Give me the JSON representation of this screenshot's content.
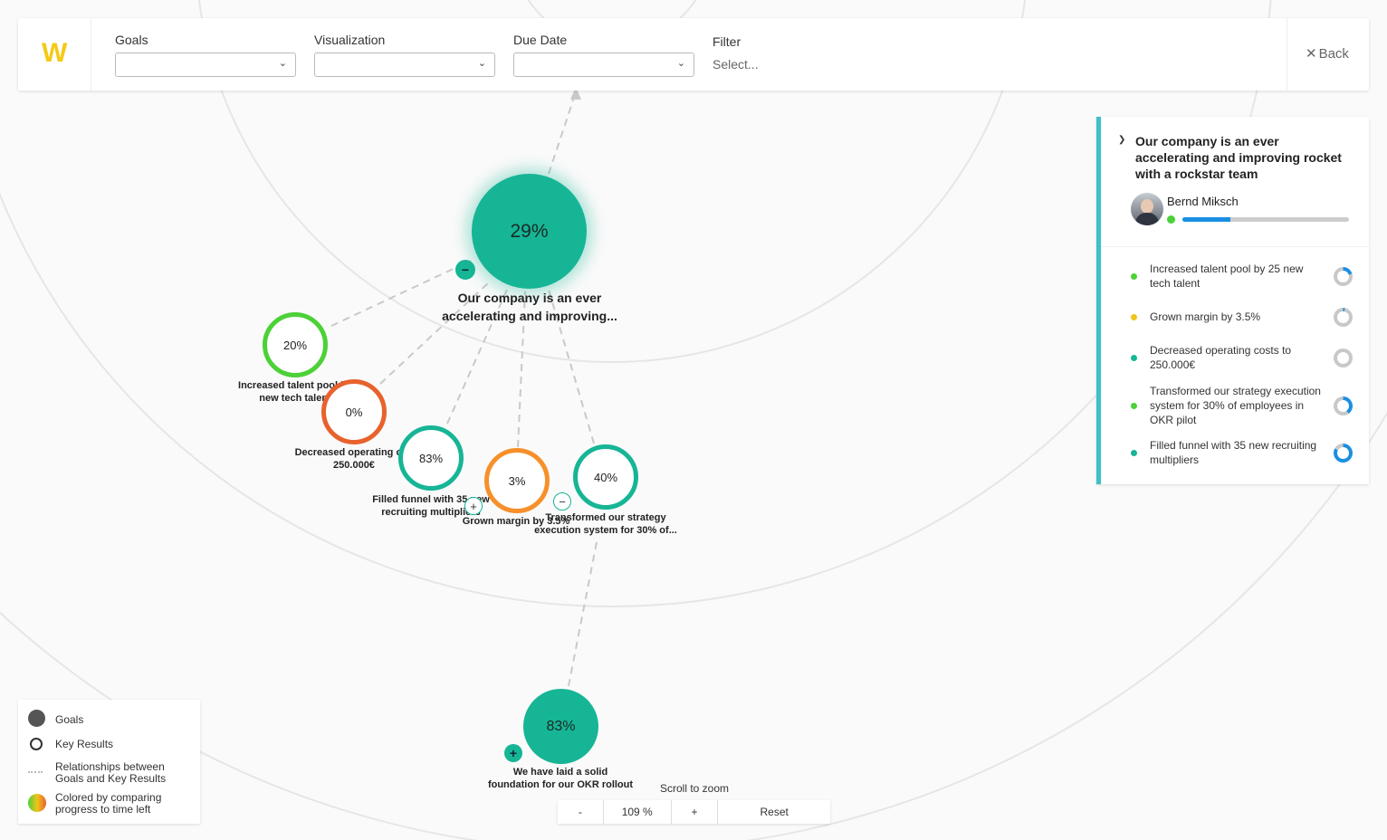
{
  "header": {
    "logo_text": "W",
    "goals_label": "Goals",
    "goals_value": "",
    "visualization_label": "Visualization",
    "visualization_value": "",
    "due_date_label": "Due Date",
    "due_date_value": "",
    "filter_label": "Filter",
    "filter_placeholder": "Select...",
    "back_label": "Back"
  },
  "graph": {
    "goal_main": {
      "progress": "29%",
      "label": "Our company is an ever accelerating and improving...",
      "color": "#16b596"
    },
    "goal_sub": {
      "progress": "83%",
      "label_line1": "We have laid a solid",
      "label_line2": "foundation for our OKR rollout",
      "color": "#16b596"
    },
    "key_results": [
      {
        "progress": "20%",
        "label_line1": "Increased talent pool by",
        "label_line2": "new tech talent",
        "color": "#4cd137"
      },
      {
        "progress": "0%",
        "label_line1": "Decreased operating cos",
        "label_line2": "250.000€",
        "color": "#e8622d"
      },
      {
        "progress": "83%",
        "label_line1": "Filled funnel with 35 new",
        "label_line2": "recruiting multipliers",
        "color": "#16b596"
      },
      {
        "progress": "3%",
        "label_line1": "Grown margin by 3.5%",
        "label_line2": "",
        "color": "#f7902b"
      },
      {
        "progress": "40%",
        "label_line1": "Transformed our strategy",
        "label_line2": "execution system for 30% of...",
        "color": "#16b596"
      }
    ],
    "toggle_collapse": "−",
    "toggle_expand": "+"
  },
  "panel": {
    "title": "Our company is an ever accelerating and improving rocket with a rockstar team",
    "owner_name": "Bernd Miksch",
    "owner_progress": 0.29,
    "owner_status_color": "#4cd137",
    "key_results": [
      {
        "label": "Increased talent pool by 25 new tech talent",
        "status_color": "#4cd137",
        "progress": 0.2
      },
      {
        "label": "Grown margin by 3.5%",
        "status_color": "#f0c419",
        "progress": 0.03
      },
      {
        "label": "Decreased operating costs to 250.000€",
        "status_color": "#16b596",
        "progress": 0.0
      },
      {
        "label": "Transformed our strategy execution system for 30% of employees in OKR pilot",
        "status_color": "#4cd137",
        "progress": 0.4
      },
      {
        "label": "Filled funnel with 35 new recruiting multipliers",
        "status_color": "#16b596",
        "progress": 0.83
      }
    ]
  },
  "legend": {
    "goals": "Goals",
    "key_results": "Key Results",
    "relationships_line1": "Relationships between",
    "relationships_line2": "Goals and Key Results",
    "colored_line1": "Colored by comparing",
    "colored_line2": "progress to time left"
  },
  "zoom": {
    "hint": "Scroll to zoom",
    "minus": "-",
    "level": "109 %",
    "plus": "+",
    "reset": "Reset"
  }
}
